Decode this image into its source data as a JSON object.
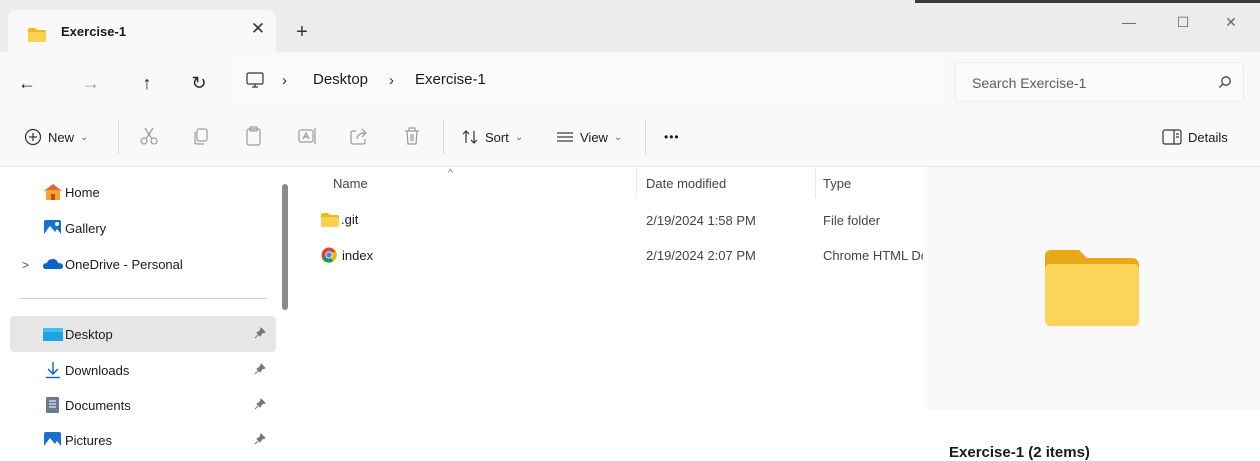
{
  "tab": {
    "title": "Exercise-1",
    "close_glyph": "✕",
    "new_glyph": "+"
  },
  "window_controls": {
    "minimize": "—",
    "maximize": "☐",
    "close": "✕"
  },
  "nav": {
    "back": "←",
    "forward": "→",
    "up": "↑",
    "refresh": "↻"
  },
  "breadcrumb": {
    "sep": "›",
    "items": [
      "Desktop",
      "Exercise-1"
    ]
  },
  "search": {
    "placeholder": "Search Exercise-1"
  },
  "toolbar": {
    "new_label": "New",
    "sort_label": "Sort",
    "view_label": "View",
    "more_label": "•••",
    "details_label": "Details",
    "chevron": "⌄"
  },
  "sidebar": {
    "items": [
      {
        "label": "Home",
        "icon": "home-icon"
      },
      {
        "label": "Gallery",
        "icon": "gallery-icon"
      },
      {
        "label": "OneDrive - Personal",
        "icon": "onedrive-icon"
      },
      {
        "label": "Desktop",
        "icon": "desktop-icon",
        "pinned": true,
        "selected": true
      },
      {
        "label": "Downloads",
        "icon": "downloads-icon",
        "pinned": true
      },
      {
        "label": "Documents",
        "icon": "documents-icon",
        "pinned": true
      },
      {
        "label": "Pictures",
        "icon": "pictures-icon",
        "pinned": true
      }
    ],
    "expander": ">"
  },
  "file_list": {
    "sort_caret": "^",
    "columns": [
      "Name",
      "Date modified",
      "Type"
    ],
    "rows": [
      {
        "name": ".git",
        "date": "2/19/2024 1:58 PM",
        "type": "File folder",
        "icon": "folder-icon"
      },
      {
        "name": "index",
        "date": "2/19/2024 2:07 PM",
        "type": "Chrome HTML Do",
        "icon": "chrome-icon"
      }
    ]
  },
  "preview": {
    "title": "Exercise-1 (2 items)"
  },
  "colors": {
    "accent": "#0067c0",
    "folder": "#f5c542",
    "selected": "#e6e6e6"
  }
}
